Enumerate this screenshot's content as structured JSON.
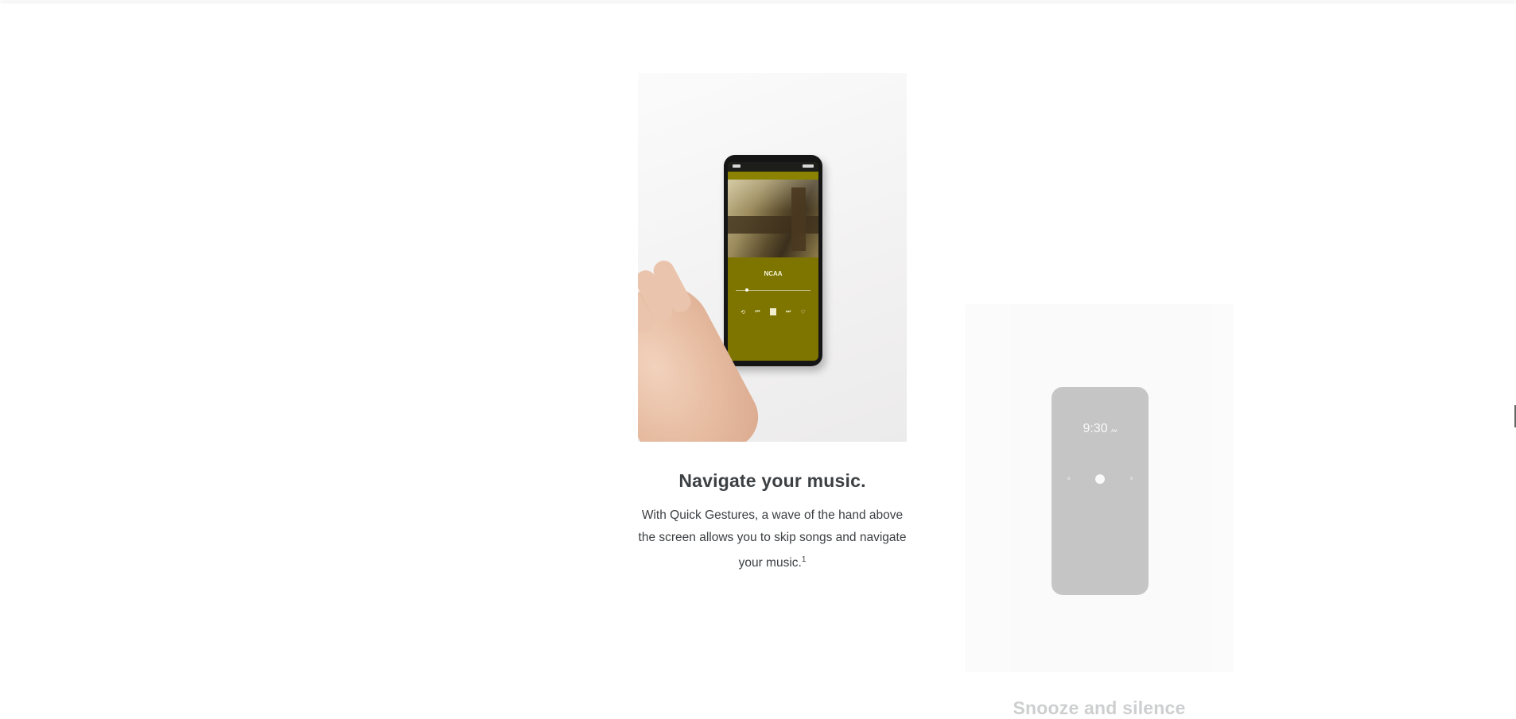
{
  "cards": [
    {
      "title": "Navigate your music.",
      "description": "With Quick Gestures, a wave of the hand above the screen allows you to skip songs and navigate your music.",
      "footnote": "1",
      "phone": {
        "track_title": "NCAA",
        "track_subtitle": "",
        "controls": [
          "⟲",
          "⏮",
          "⏭",
          "♡"
        ]
      }
    },
    {
      "title": "Snooze and silence",
      "phone": {
        "clock_time": "9:30",
        "clock_period": "AM",
        "left_icon": "≡",
        "right_icon": "≡"
      }
    }
  ],
  "colors": {
    "heading": "#3c4043",
    "body_text": "#3c4043",
    "music_screen": "#7d7500"
  }
}
